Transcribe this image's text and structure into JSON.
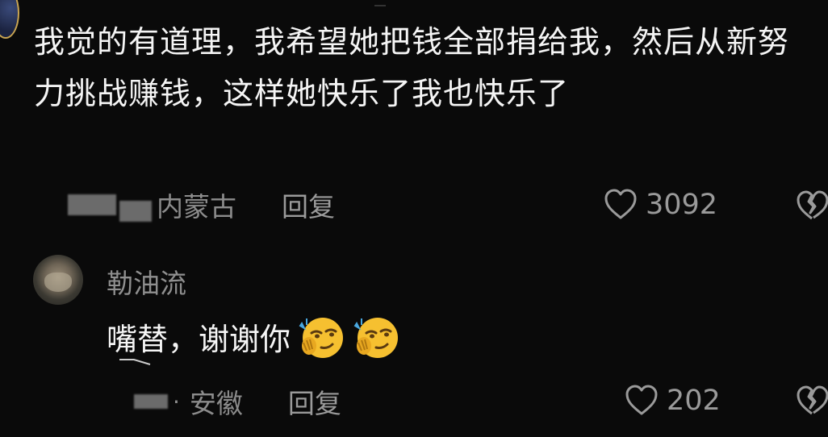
{
  "comment": {
    "text": "我觉的有道理，我希望她把钱全部捐给我，然后从新努力挑战赚钱，这样她快乐了我也快乐了",
    "location": "内蒙古",
    "reply_label": "回复",
    "like_count": "3092"
  },
  "reply_comment": {
    "username": "勒油流",
    "text": "嘴替，谢谢你",
    "emojis": [
      "shy-smirk-emoji",
      "shy-smirk-emoji"
    ],
    "location": "安徽",
    "separator": "·",
    "reply_label": "回复",
    "like_count": "202"
  },
  "icons": {
    "like": "heart-outline-icon",
    "dislike": "broken-heart-icon"
  },
  "colors": {
    "background": "#0a0a0a",
    "primary_text": "#f5f5f5",
    "secondary_text": "#8c8c8c"
  }
}
